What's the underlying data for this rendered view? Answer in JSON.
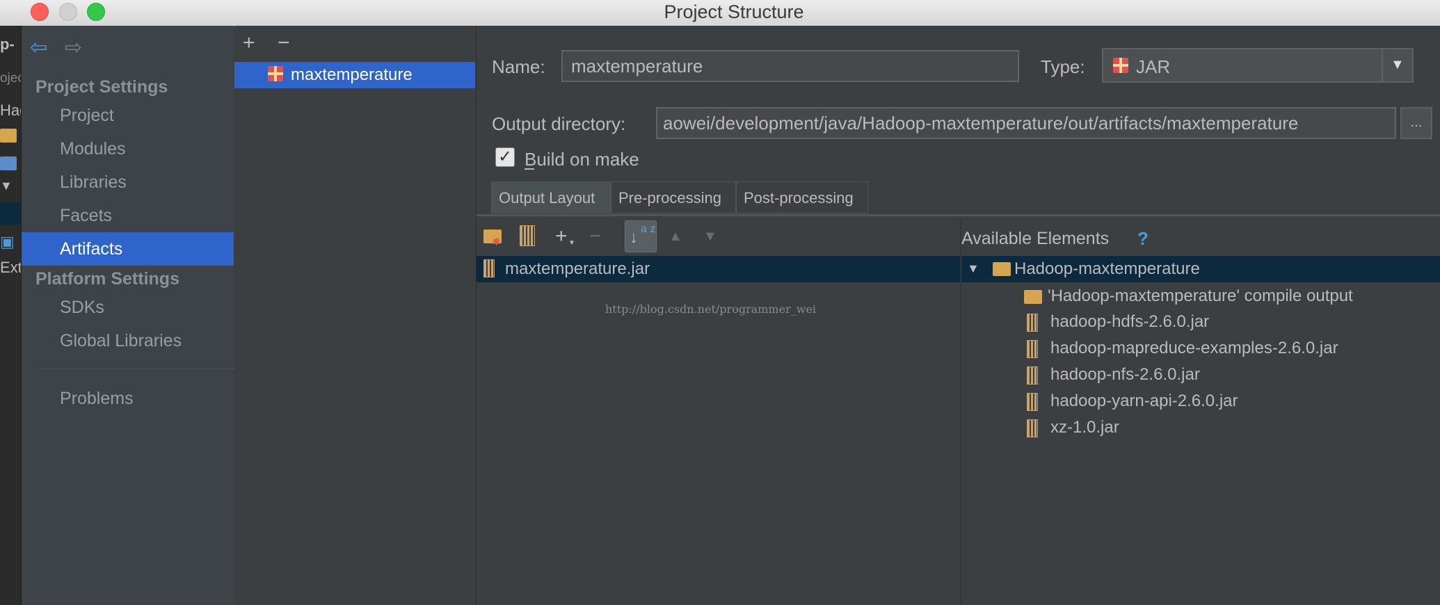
{
  "window": {
    "title": "Project Structure"
  },
  "background_strip": {
    "texts": [
      "p-",
      "ojec",
      "Had",
      "Ext"
    ]
  },
  "nav": {
    "project_settings_header": "Project Settings",
    "project_items": [
      "Project",
      "Modules",
      "Libraries",
      "Facets"
    ],
    "selected_item": "Artifacts",
    "platform_settings_header": "Platform Settings",
    "platform_items": [
      "SDKs",
      "Global Libraries"
    ],
    "problems": "Problems"
  },
  "artifacts_list": {
    "add_label": "+",
    "remove_label": "−",
    "items": [
      "maxtemperature"
    ]
  },
  "form": {
    "name_label": "Name:",
    "name_value": "maxtemperature",
    "type_label": "Type:",
    "type_value": "JAR",
    "output_dir_label": "Output directory:",
    "output_dir_value": "aowei/development/java/Hadoop-maxtemperature/out/artifacts/maxtemperature",
    "browse_label": "...",
    "build_on_make_label": "Build on make",
    "build_on_make_checked": true
  },
  "tabs": [
    "Output Layout",
    "Pre-processing",
    "Post-processing"
  ],
  "active_tab": "Output Layout",
  "output_layout": {
    "toolbar": {
      "add_label": "+",
      "remove_label": "−",
      "sort_label": "a z"
    },
    "root_item": "maxtemperature.jar",
    "watermark": "http://blog.csdn.net/programmer_wei"
  },
  "available_elements": {
    "title": "Available Elements",
    "help_label": "?",
    "root": "Hadoop-maxtemperature",
    "children": [
      "'Hadoop-maxtemperature' compile output",
      "hadoop-hdfs-2.6.0.jar",
      "hadoop-mapreduce-examples-2.6.0.jar",
      "hadoop-nfs-2.6.0.jar",
      "hadoop-yarn-api-2.6.0.jar",
      "xz-1.0.jar"
    ]
  },
  "colors": {
    "selection": "#2f65ca",
    "panel": "#3c3f41",
    "sidebar": "#3d4349",
    "tree_selection": "#0d293e"
  },
  "icons": [
    "back-arrow-icon",
    "forward-arrow-icon",
    "gift-icon",
    "folder-icon",
    "jar-icon",
    "sort-icon",
    "help-icon",
    "chevron-down-icon"
  ]
}
